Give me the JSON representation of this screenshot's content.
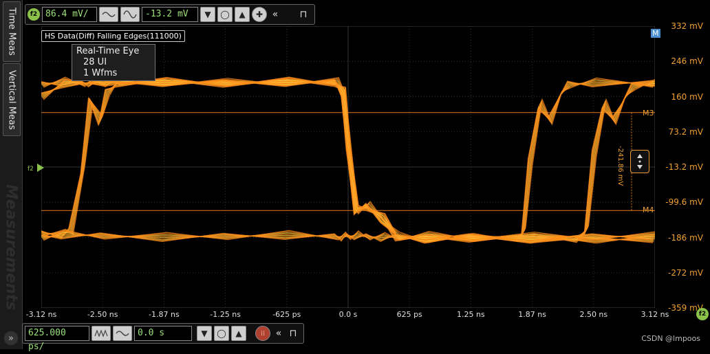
{
  "side_tabs": {
    "time_meas": "Time Meas",
    "vertical_meas": "Vertical Meas",
    "measurements": "Measurements"
  },
  "vertical_toolbar": {
    "channel": "f2",
    "scale": "86.4 mV/",
    "offset": "-13.2 mV"
  },
  "horizontal_toolbar": {
    "scale": "625.000 ps/",
    "position": "0.0 s"
  },
  "waveform_label": "HS Data(Diff) Falling Edges(111000)",
  "info": {
    "title": "Real-Time Eye",
    "ui": "28 UI",
    "wfms": "1 Wfms"
  },
  "markers": {
    "m1": "M",
    "m3": "M3",
    "m4": "M4",
    "delta": "-241.86 mV",
    "channel_ref": "f2"
  },
  "colors": {
    "trace": "#ff8c1a",
    "trace_hot": "#ffd040",
    "accent": "#8bc34a",
    "axis_labels": "#f0a030"
  },
  "footer": "CSDN @lmpoos",
  "chart_data": {
    "type": "line",
    "xlabel": "",
    "ylabel": "",
    "x_ticks": [
      "-3.12 ns",
      "-2.50 ns",
      "-1.87 ns",
      "-1.25 ns",
      "-625 ps",
      "0.0 s",
      "625 ps",
      "1.25 ns",
      "1.87 ns",
      "2.50 ns",
      "3.12 ns"
    ],
    "y_ticks": [
      "332 mV",
      "246 mV",
      "160 mV",
      "73.2 mV",
      "-13.2 mV",
      "-99.6 mV",
      "-186 mV",
      "-272 mV",
      "-359 mV"
    ],
    "xlim_ns": [
      -3.12,
      3.12
    ],
    "ylim_mV": [
      -359,
      332
    ],
    "grid": true,
    "marker_levels_mV": {
      "M3": 120,
      "M4": -120
    },
    "series": [
      {
        "x_ns": [
          -3.12,
          -2.9,
          -2.7,
          -2.62,
          -2.52,
          -2.45,
          -2.35,
          -1.87,
          -1.25,
          -0.625,
          -0.12,
          -0.05,
          0.0,
          0.08,
          0.2,
          0.35,
          0.5,
          0.8,
          1.25,
          1.87,
          2.5,
          3.12
        ],
        "y_mV": [
          190,
          195,
          192,
          193,
          194,
          193,
          196,
          194,
          193,
          195,
          194,
          170,
          40,
          -120,
          -110,
          -140,
          -185,
          -190,
          -188,
          -190,
          -192,
          -189
        ]
      },
      {
        "x_ns": [
          -3.12,
          -2.9,
          -2.82,
          -2.7,
          -2.62,
          -2.52,
          -2.45,
          -2.35,
          -1.87,
          -1.25,
          -0.625,
          -0.12,
          -0.05,
          0.0,
          0.08,
          0.2,
          0.35,
          0.5,
          0.8,
          1.25,
          1.7,
          1.78,
          1.85,
          1.95,
          2.05,
          2.15,
          2.25,
          2.5,
          3.12
        ],
        "y_mV": [
          -175,
          -178,
          -170,
          -20,
          150,
          100,
          170,
          192,
          194,
          192,
          195,
          194,
          170,
          40,
          -120,
          -110,
          -140,
          -185,
          -190,
          -188,
          -188,
          -175,
          0,
          140,
          100,
          160,
          190,
          193,
          192
        ]
      },
      {
        "x_ns": [
          -3.12,
          -2.9,
          -2.5,
          -1.87,
          -1.25,
          -0.625,
          -0.12,
          -0.05,
          0.0,
          0.08,
          0.2,
          0.35,
          0.5,
          0.8,
          1.25,
          1.87,
          2.3,
          2.42,
          2.5,
          2.6,
          2.7,
          2.8,
          2.9,
          3.12
        ],
        "y_mV": [
          160,
          190,
          193,
          194,
          193,
          194,
          194,
          170,
          40,
          -120,
          -110,
          -140,
          -185,
          -190,
          -188,
          -190,
          -190,
          -170,
          20,
          140,
          100,
          150,
          185,
          192
        ]
      },
      {
        "x_ns": [
          -3.12,
          -2.9,
          -2.5,
          -1.87,
          -1.25,
          -0.625,
          -0.12,
          -0.05,
          0.0,
          0.08,
          0.2,
          0.35,
          0.5,
          0.8,
          1.25,
          1.87,
          2.5,
          3.12
        ],
        "y_mV": [
          -185,
          -180,
          -182,
          -186,
          -183,
          -181,
          -184,
          -185,
          -183,
          -182,
          -184,
          -186,
          -185,
          -183,
          -184,
          -185,
          -184,
          -183
        ]
      }
    ]
  }
}
